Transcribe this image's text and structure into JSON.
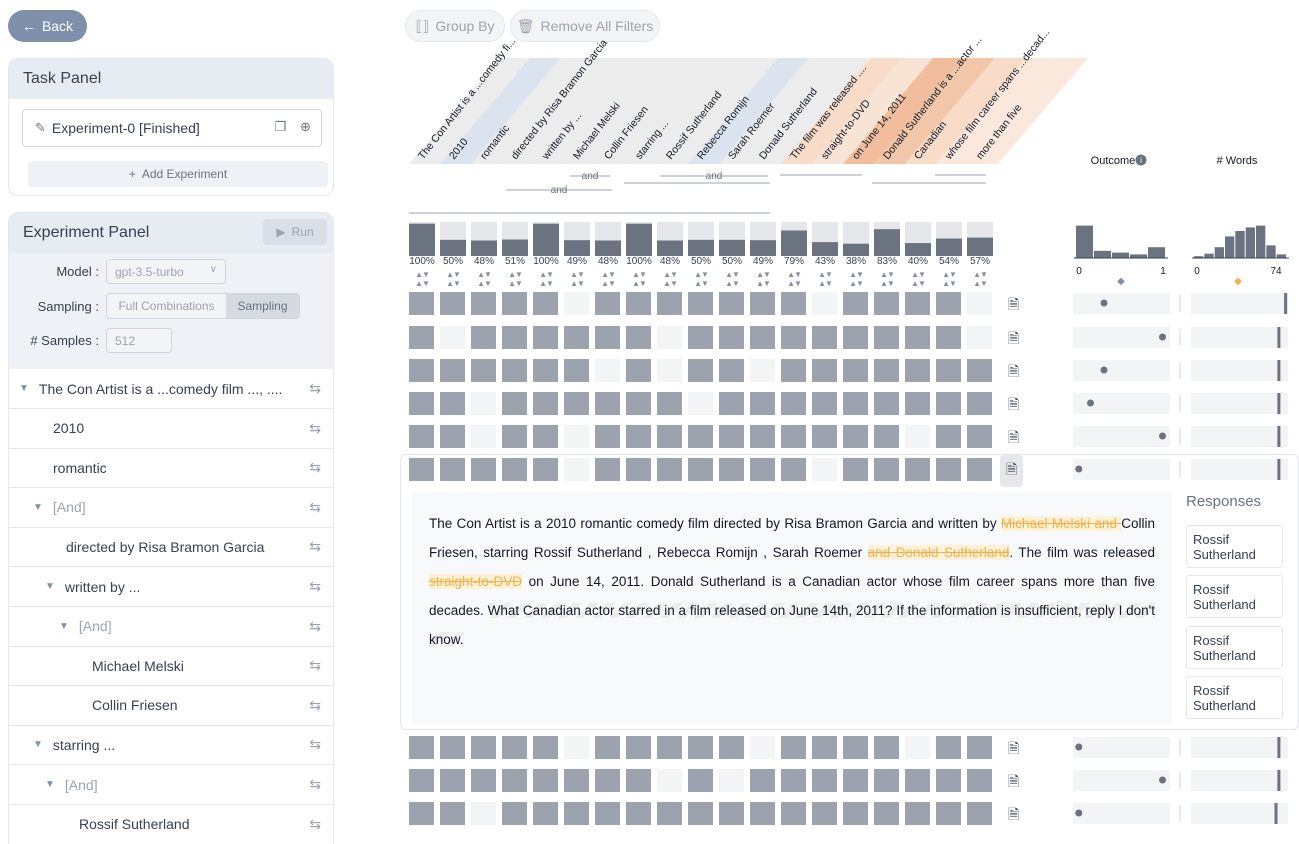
{
  "back_label": "Back",
  "task_panel": {
    "title": "Task Panel",
    "experiment_name": "Experiment-0 [Finished]",
    "add_experiment_label": "Add Experiment"
  },
  "experiment_panel": {
    "title": "Experiment Panel",
    "run_label": "Run",
    "model_label": "Model",
    "model_value": "gpt-3.5-turbo",
    "sampling_label": "Sampling",
    "sampling_options": [
      "Full Combinations",
      "Sampling"
    ],
    "sampling_selected": "Sampling",
    "samples_label": "# Samples",
    "samples_value": "512"
  },
  "tree": [
    {
      "label": "The Con Artist is a ...comedy film ..., ....",
      "expanded": true,
      "muted": false
    },
    {
      "label": "2010",
      "muted": false
    },
    {
      "label": "romantic",
      "muted": false
    },
    {
      "label": "[And]",
      "expanded": true,
      "muted": true
    },
    {
      "label": "directed by Risa Bramon Garcia",
      "muted": false
    },
    {
      "label": "written by ...",
      "expanded": true,
      "muted": false
    },
    {
      "label": "[And]",
      "expanded": true,
      "muted": true
    },
    {
      "label": "Michael Melski",
      "muted": false
    },
    {
      "label": "Collin Friesen",
      "muted": false
    },
    {
      "label": "starring ...",
      "expanded": true,
      "muted": false
    },
    {
      "label": "[And]",
      "expanded": true,
      "muted": true
    },
    {
      "label": "Rossif Sutherland",
      "muted": false
    }
  ],
  "toolbar": {
    "group_by_label": "Group By",
    "remove_filters_label": "Remove All Filters"
  },
  "columns": [
    {
      "label": "The Con Artist is a ...comedy fi...",
      "percent": "100%",
      "value": 1.0
    },
    {
      "label": "2010",
      "percent": "50%",
      "value": 0.5
    },
    {
      "label": "romantic",
      "percent": "48%",
      "value": 0.48
    },
    {
      "label": "directed by Risa Bramon Garcia",
      "percent": "51%",
      "value": 0.51
    },
    {
      "label": "written by ...",
      "percent": "100%",
      "value": 1.0
    },
    {
      "label": "Michael Melski",
      "percent": "49%",
      "value": 0.49
    },
    {
      "label": "Collin Friesen",
      "percent": "48%",
      "value": 0.48
    },
    {
      "label": "starring ...",
      "percent": "100%",
      "value": 1.0
    },
    {
      "label": "Rossif Sutherland",
      "percent": "48%",
      "value": 0.48
    },
    {
      "label": "Rebecca Romijn",
      "percent": "50%",
      "value": 0.5
    },
    {
      "label": "Sarah Roemer",
      "percent": "50%",
      "value": 0.5
    },
    {
      "label": "Donald Sutherland",
      "percent": "49%",
      "value": 0.49
    },
    {
      "label": "The film was released ....",
      "percent": "79%",
      "value": 0.79
    },
    {
      "label": "straight-to-DVD",
      "percent": "43%",
      "value": 0.43
    },
    {
      "label": "on June 14, 2011",
      "percent": "38%",
      "value": 0.38
    },
    {
      "label": "Donald Sutherland is a ...actor ...",
      "percent": "83%",
      "value": 0.83
    },
    {
      "label": "Canadian",
      "percent": "40%",
      "value": 0.4
    },
    {
      "label": "whose film career spans ...decad...",
      "percent": "54%",
      "value": 0.54
    },
    {
      "label": "more than five",
      "percent": "57%",
      "value": 0.57
    }
  ],
  "and_label": "and",
  "outcome": {
    "label": "Outcome",
    "min": "0",
    "max": "1",
    "hist": [
      0.9,
      0.2,
      0.15,
      0.1,
      0.3
    ]
  },
  "words": {
    "label": "# Words",
    "min": "0",
    "max": "74",
    "hist": [
      0.05,
      0.12,
      0.3,
      0.6,
      0.75,
      0.85,
      0.9,
      0.35,
      0.1
    ]
  },
  "rows": [
    {
      "cells": [
        1,
        1,
        1,
        1,
        1,
        0,
        1,
        1,
        1,
        1,
        1,
        1,
        1,
        0,
        1,
        1,
        1,
        1,
        0
      ],
      "outcome": 0.3,
      "words": 0.97
    },
    {
      "cells": [
        1,
        0,
        1,
        1,
        1,
        1,
        1,
        1,
        0,
        1,
        1,
        1,
        1,
        1,
        1,
        1,
        1,
        1,
        0
      ],
      "outcome": 0.95,
      "words": 0.9
    },
    {
      "cells": [
        1,
        1,
        1,
        1,
        1,
        1,
        0,
        1,
        0,
        1,
        1,
        0,
        1,
        1,
        1,
        1,
        1,
        1,
        1
      ],
      "outcome": 0.3,
      "words": 0.9
    },
    {
      "cells": [
        1,
        1,
        0,
        1,
        1,
        1,
        1,
        1,
        1,
        0,
        1,
        1,
        1,
        1,
        1,
        1,
        1,
        1,
        1
      ],
      "outcome": 0.15,
      "words": 0.9
    },
    {
      "cells": [
        1,
        1,
        0,
        1,
        1,
        0,
        1,
        1,
        1,
        1,
        1,
        1,
        1,
        1,
        1,
        1,
        0,
        1,
        1
      ],
      "outcome": 0.95,
      "words": 0.9
    },
    {
      "cells": [
        1,
        1,
        1,
        1,
        1,
        0,
        1,
        1,
        1,
        1,
        1,
        1,
        1,
        0,
        1,
        1,
        1,
        1,
        1
      ],
      "outcome": 0.02,
      "words": 0.9
    },
    {
      "cells": [
        1,
        1,
        1,
        1,
        1,
        0,
        1,
        1,
        1,
        1,
        1,
        0,
        1,
        1,
        1,
        1,
        0,
        1,
        1
      ],
      "outcome": 0.02,
      "words": 0.9
    },
    {
      "cells": [
        1,
        1,
        1,
        1,
        1,
        1,
        1,
        1,
        0,
        1,
        0,
        1,
        1,
        1,
        1,
        1,
        1,
        1,
        1
      ],
      "outcome": 0.95,
      "words": 0.9
    },
    {
      "cells": [
        1,
        1,
        0,
        1,
        1,
        1,
        1,
        1,
        1,
        1,
        1,
        1,
        1,
        1,
        1,
        1,
        1,
        1,
        1
      ],
      "outcome": 0.02,
      "words": 0.87
    }
  ],
  "prompt": {
    "p1": "The Con Artist is a 2010 romantic comedy film directed by Risa Bramon Garcia and written by ",
    "d1": "Michael Melski and ",
    "p2": "Collin Friesen, starring Rossif Sutherland , Rebecca Romijn , Sarah Roemer ",
    "d2": "and Donald Sutherland",
    "p3": ". The film was released ",
    "d3": "straight-to-DVD",
    "p4": " on June 14, 2011. Donald Sutherland is a Canadian actor whose film career spans more than five decades.",
    "q": "What Canadian actor starred in a film released on June 14th, 2011? If the information is insufficient, reply I don't know."
  },
  "responses": {
    "title": "Responses",
    "items": [
      "Rossif Sutherland",
      "Rossif Sutherland",
      "Rossif Sutherland",
      "Rossif Sutherland"
    ]
  },
  "colors": {
    "accent": "#7f90aa",
    "cell": "#9ca3af",
    "bar": "#6b7280",
    "orange": "#f0b24a"
  }
}
